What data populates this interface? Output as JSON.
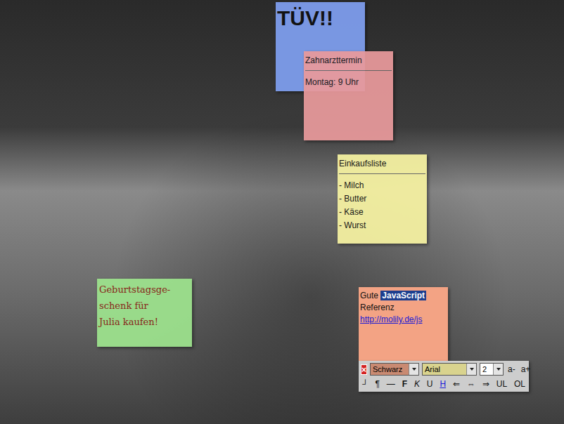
{
  "background": {
    "kind": "photo"
  },
  "notes": [
    {
      "kind": "heading",
      "color": "#7f9ff0",
      "text": "TÜV!!"
    },
    {
      "kind": "titled",
      "color": "#e99a9c",
      "title": "Zahnarzttermin",
      "lines": [
        "Montag: 9 Uhr"
      ]
    },
    {
      "kind": "titled",
      "color": "#f7f3a2",
      "title": "Einkaufsliste",
      "lines": [
        "- Milch",
        "- Butter",
        "- Käse",
        "- Wurst"
      ]
    },
    {
      "kind": "plain",
      "color": "#9ee48e",
      "lines": [
        "Geburtstagsge-",
        "schenk für",
        "Julia kaufen!"
      ]
    },
    {
      "kind": "rich",
      "color": "#f3a384",
      "lines": [
        [
          {
            "text": "Gute ",
            "kind": "text"
          },
          {
            "text": "JavaScript",
            "kind": "selected"
          }
        ],
        [
          {
            "text": "Referenz",
            "kind": "text"
          }
        ],
        [
          {
            "text": "http://molily.de/js",
            "kind": "link"
          }
        ]
      ]
    }
  ],
  "toolbar": {
    "close": "×",
    "dropdowns": [
      {
        "value": "Schwarz",
        "color": "#c98a72"
      },
      {
        "value": "Arial",
        "color": "#d9d38e"
      },
      {
        "value": "2",
        "color": "#ffffff"
      }
    ],
    "size_buttons": [
      "a-",
      "a+"
    ],
    "format_buttons": [
      {
        "text": "┘",
        "kind": "plain"
      },
      {
        "text": "¶",
        "kind": "plain"
      },
      {
        "text": "—",
        "kind": "plain"
      },
      {
        "text": "F",
        "kind": "bold"
      },
      {
        "text": "K",
        "kind": "italic"
      },
      {
        "text": "U",
        "kind": "plain"
      },
      {
        "text": "H",
        "kind": "link"
      },
      {
        "text": "⇐",
        "kind": "plain"
      },
      {
        "text": "⇔",
        "kind": "plain"
      },
      {
        "text": "⇒",
        "kind": "plain"
      },
      {
        "text": "UL",
        "kind": "plain"
      },
      {
        "text": "OL",
        "kind": "plain"
      }
    ]
  }
}
